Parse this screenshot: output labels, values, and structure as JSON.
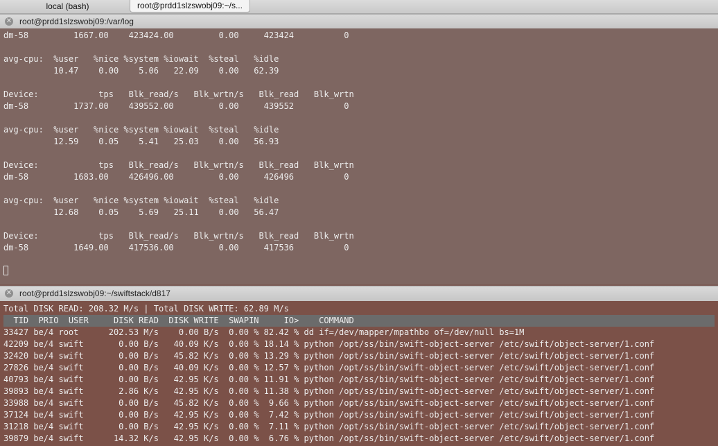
{
  "tabs": [
    {
      "label": "local (bash)"
    },
    {
      "label": "root@prdd1slzswobj09:~/s..."
    }
  ],
  "pane1": {
    "title": "root@prdd1slzswobj09:/var/log",
    "lines": [
      "dm-58         1667.00    423424.00         0.00     423424          0",
      "",
      "avg-cpu:  %user   %nice %system %iowait  %steal   %idle",
      "          10.47    0.00    5.06   22.09    0.00   62.39",
      "",
      "Device:            tps   Blk_read/s   Blk_wrtn/s   Blk_read   Blk_wrtn",
      "dm-58         1737.00    439552.00         0.00     439552          0",
      "",
      "avg-cpu:  %user   %nice %system %iowait  %steal   %idle",
      "          12.59    0.05    5.41   25.03    0.00   56.93",
      "",
      "Device:            tps   Blk_read/s   Blk_wrtn/s   Blk_read   Blk_wrtn",
      "dm-58         1683.00    426496.00         0.00     426496          0",
      "",
      "avg-cpu:  %user   %nice %system %iowait  %steal   %idle",
      "          12.68    0.05    5.69   25.11    0.00   56.47",
      "",
      "Device:            tps   Blk_read/s   Blk_wrtn/s   Blk_read   Blk_wrtn",
      "dm-58         1649.00    417536.00         0.00     417536          0"
    ]
  },
  "pane2": {
    "title": "root@prdd1slzswobj09:~/swiftstack/d817",
    "totals": "Total DISK READ: 208.32 M/s | Total DISK WRITE: 62.89 M/s",
    "header": "  TID  PRIO  USER     DISK READ  DISK WRITE  SWAPIN     IO>    COMMAND",
    "rows": [
      "33427 be/4 root      202.53 M/s    0.00 B/s  0.00 % 82.42 % dd if=/dev/mapper/mpathbo of=/dev/null bs=1M",
      "42209 be/4 swift       0.00 B/s   40.09 K/s  0.00 % 18.14 % python /opt/ss/bin/swift-object-server /etc/swift/object-server/1.conf",
      "32420 be/4 swift       0.00 B/s   45.82 K/s  0.00 % 13.29 % python /opt/ss/bin/swift-object-server /etc/swift/object-server/1.conf",
      "27826 be/4 swift       0.00 B/s   40.09 K/s  0.00 % 12.57 % python /opt/ss/bin/swift-object-server /etc/swift/object-server/1.conf",
      "40793 be/4 swift       0.00 B/s   42.95 K/s  0.00 % 11.91 % python /opt/ss/bin/swift-object-server /etc/swift/object-server/1.conf",
      "39893 be/4 swift       2.86 K/s   42.95 K/s  0.00 % 11.38 % python /opt/ss/bin/swift-object-server /etc/swift/object-server/1.conf",
      "33988 be/4 swift       0.00 B/s   45.82 K/s  0.00 %  9.66 % python /opt/ss/bin/swift-object-server /etc/swift/object-server/1.conf",
      "37124 be/4 swift       0.00 B/s   42.95 K/s  0.00 %  7.42 % python /opt/ss/bin/swift-object-server /etc/swift/object-server/1.conf",
      "31218 be/4 swift       0.00 B/s   42.95 K/s  0.00 %  7.11 % python /opt/ss/bin/swift-object-server /etc/swift/object-server/1.conf",
      "39879 be/4 swift      14.32 K/s   42.95 K/s  0.00 %  6.76 % python /opt/ss/bin/swift-object-server /etc/swift/object-server/1.conf"
    ]
  },
  "colors": {
    "pane1_bg": "#7e6661",
    "pane2_bg": "#7b5148",
    "text": "#ececec",
    "header_bar": "#6b6b6b"
  },
  "icons": {
    "close": "close-icon"
  }
}
